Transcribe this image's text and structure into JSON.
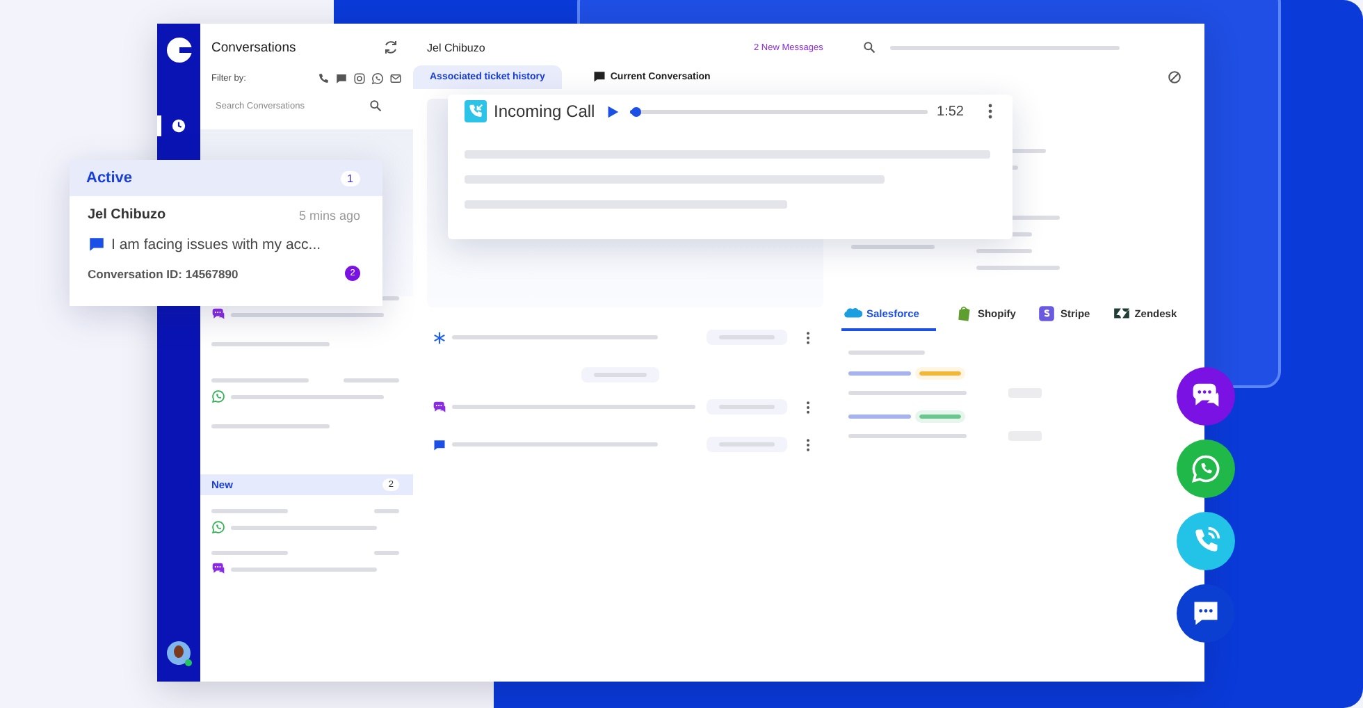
{
  "nav_rail": {
    "items": [
      {
        "kind": "clock",
        "selected": true
      }
    ]
  },
  "conversations_panel": {
    "title": "Conversations",
    "filter_label": "Filter by:",
    "filters": [
      {
        "kind": "phone"
      },
      {
        "kind": "message"
      },
      {
        "kind": "instagram"
      },
      {
        "kind": "whatsapp"
      },
      {
        "kind": "mail"
      }
    ],
    "search": {
      "placeholder": "Search Conversations"
    },
    "conversations": [
      {
        "kind": "chat"
      },
      {
        "kind": "whatsapp"
      }
    ],
    "new_section": {
      "label": "New",
      "count": "2",
      "conversations": [
        {
          "kind": "whatsapp"
        },
        {
          "kind": "chat"
        }
      ]
    }
  },
  "active_card": {
    "label": "Active",
    "count": "1",
    "conversation": {
      "name": "Jel Chibuzo",
      "time": "5 mins ago",
      "message": "I am facing issues with my acc...",
      "id_text": "Conversation ID: 14567890",
      "unread": "2"
    }
  },
  "header": {
    "contact_name": "Jel Chibuzo",
    "new_messages": "2 New Messages"
  },
  "tabs": [
    {
      "label": "Associated ticket history",
      "selected": true
    },
    {
      "label": "Current Conversation",
      "selected": false
    }
  ],
  "call_card": {
    "title": "Incoming Call",
    "level": 0.02,
    "duration": "1:52"
  },
  "timeline": [
    {
      "kind": "asterisk"
    },
    {
      "kind": "chat"
    },
    {
      "kind": "message"
    }
  ],
  "integrations": [
    {
      "label": "Salesforce",
      "kind": "salesforce",
      "selected": true
    },
    {
      "label": "Shopify",
      "kind": "shopify",
      "selected": false
    },
    {
      "label": "Stripe",
      "kind": "stripe",
      "selected": false
    },
    {
      "label": "Zendesk",
      "kind": "zendesk",
      "selected": false
    }
  ],
  "channel_buttons": [
    {
      "kind": "chat",
      "color": "#7a12e3"
    },
    {
      "kind": "whatsapp",
      "color": "#21b84a"
    },
    {
      "kind": "call",
      "color": "#22c3e6"
    },
    {
      "kind": "message",
      "color": "#0a3fd1"
    }
  ]
}
